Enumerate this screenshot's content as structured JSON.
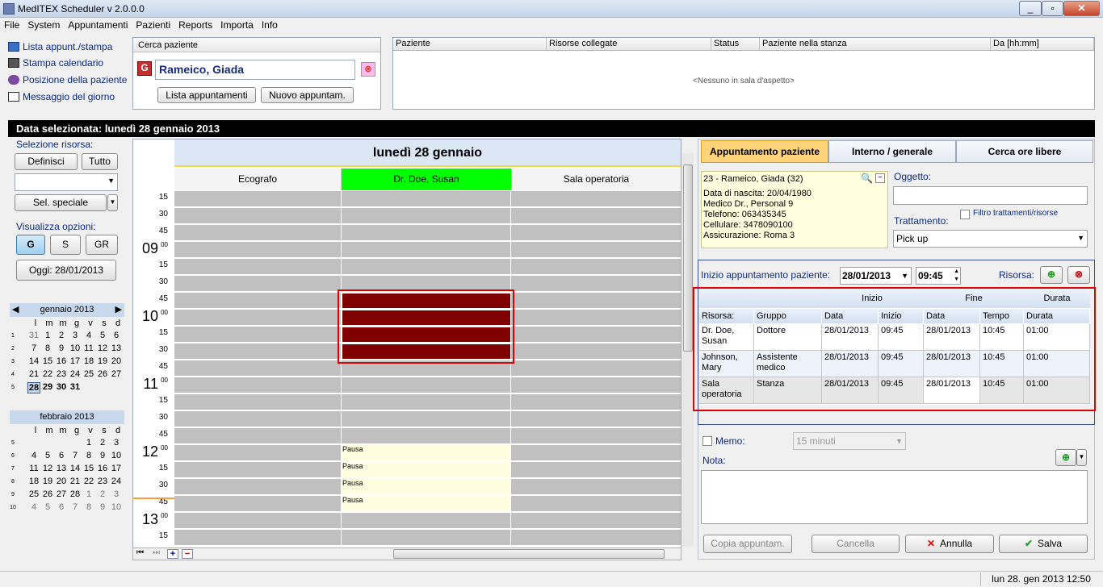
{
  "window": {
    "title": "MedITEX  Scheduler v 2.0.0.0",
    "min": "_",
    "max": "▫",
    "close": "✕"
  },
  "menu": [
    "File",
    "System",
    "Appuntamenti",
    "Pazienti",
    "Reports",
    "Importa",
    "Info"
  ],
  "left_links": [
    "Lista appunt./stampa",
    "Stampa calendario",
    "Posizione della paziente",
    "Messaggio del giorno"
  ],
  "search": {
    "title": "Cerca paziente",
    "patient": "Rameico, Giada",
    "btn_list": "Lista appuntamenti",
    "btn_new": "Nuovo appuntam."
  },
  "waiting": {
    "columns": [
      "Paziente",
      "Risorse collegate",
      "Status",
      "Paziente nella stanza",
      "Da [hh:mm]"
    ],
    "empty": "<Nessuno in sala d'aspetto>"
  },
  "selected_date": "Data selezionata: lunedì 28 gennaio 2013",
  "sidebar": {
    "sel_label": "Selezione risorsa:",
    "definisci": "Definisci",
    "tutto": "Tutto",
    "sel_speciale": "Sel. speciale",
    "vis_label": "Visualizza opzioni:",
    "opt_g": "G",
    "opt_s": "S",
    "opt_gr": "GR",
    "oggi": "Oggi: 28/01/2013"
  },
  "cal_jan": {
    "title": "gennaio 2013",
    "days": [
      "l",
      "m",
      "m",
      "g",
      "v",
      "d"
    ],
    "weeks": [
      {
        "w": "1",
        "d": [
          "31",
          "1",
          "2",
          "3",
          "4",
          "5",
          "6"
        ]
      },
      {
        "w": "2",
        "d": [
          "7",
          "8",
          "9",
          "10",
          "11",
          "12",
          "13"
        ]
      },
      {
        "w": "3",
        "d": [
          "14",
          "15",
          "16",
          "17",
          "18",
          "19",
          "20"
        ]
      },
      {
        "w": "4",
        "d": [
          "21",
          "22",
          "23",
          "24",
          "25",
          "26",
          "27"
        ]
      },
      {
        "w": "5",
        "d": [
          "28",
          "29",
          "30",
          "31",
          "",
          "",
          ""
        ]
      }
    ]
  },
  "cal_feb": {
    "title": "febbraio 2013",
    "days": [
      "l",
      "m",
      "m",
      "g",
      "v",
      "d"
    ],
    "weeks": [
      {
        "w": "5",
        "d": [
          "",
          "",
          "",
          "",
          "1",
          "2",
          "3"
        ]
      },
      {
        "w": "6",
        "d": [
          "4",
          "5",
          "6",
          "7",
          "8",
          "9",
          "10"
        ]
      },
      {
        "w": "7",
        "d": [
          "11",
          "12",
          "13",
          "14",
          "15",
          "16",
          "17"
        ]
      },
      {
        "w": "8",
        "d": [
          "18",
          "19",
          "20",
          "21",
          "22",
          "23",
          "24"
        ]
      },
      {
        "w": "9",
        "d": [
          "25",
          "26",
          "27",
          "28",
          "1",
          "2",
          "3"
        ]
      },
      {
        "w": "10",
        "d": [
          "4",
          "5",
          "6",
          "7",
          "8",
          "9",
          "10"
        ]
      }
    ]
  },
  "day": {
    "title": "lunedì 28 gennaio",
    "resources": [
      "Ecografo",
      "Dr. Doe, Susan",
      "Sala operatoria"
    ],
    "times": [
      {
        "h": "",
        "m": "15"
      },
      {
        "h": "",
        "m": "30"
      },
      {
        "h": "",
        "m": "45"
      },
      {
        "h": "09",
        "m": "00"
      },
      {
        "h": "",
        "m": "15"
      },
      {
        "h": "",
        "m": "30"
      },
      {
        "h": "",
        "m": "45"
      },
      {
        "h": "10",
        "m": "00"
      },
      {
        "h": "",
        "m": "15"
      },
      {
        "h": "",
        "m": "30"
      },
      {
        "h": "",
        "m": "45"
      },
      {
        "h": "11",
        "m": "00"
      },
      {
        "h": "",
        "m": "15"
      },
      {
        "h": "",
        "m": "30"
      },
      {
        "h": "",
        "m": "45"
      },
      {
        "h": "12",
        "m": "00"
      },
      {
        "h": "",
        "m": "15"
      },
      {
        "h": "",
        "m": "30"
      },
      {
        "h": "",
        "m": "45"
      },
      {
        "h": "13",
        "m": "00"
      },
      {
        "h": "",
        "m": "15"
      }
    ],
    "pausa": "Pausa"
  },
  "tabs": [
    "Appuntamento paziente",
    "Interno / generale",
    "Cerca ore libere"
  ],
  "patient": {
    "line1": "23 - Rameico, Giada (32)",
    "lines": [
      "Data di nascita: 20/04/1980",
      "Medico Dr., Personal 9",
      "Telefono:  063435345",
      "Cellulare: 3478090100",
      "Assicurazione: Roma 3"
    ]
  },
  "form": {
    "oggetto": "Oggetto:",
    "trattamento": "Trattamento:",
    "filtro": "Filtro trattamenti/risorse",
    "trattamento_val": "Pick up",
    "inizio": "Inizio appuntamento paziente:",
    "date": "28/01/2013",
    "time": "09:45",
    "risorsa": "Risorsa:"
  },
  "rtable": {
    "groups": [
      "Inizio",
      "Fine",
      "Durata"
    ],
    "cols": [
      "Risorsa:",
      "Gruppo",
      "Data",
      "Inizio",
      "Data",
      "Tempo",
      "Durata"
    ],
    "rows": [
      [
        "Dr. Doe, Susan",
        "Dottore",
        "28/01/2013",
        "09:45",
        "28/01/2013",
        "10:45",
        "01:00"
      ],
      [
        "Johnson, Mary",
        "Assistente medico",
        "28/01/2013",
        "09:45",
        "28/01/2013",
        "10:45",
        "01:00"
      ],
      [
        "Sala operatoria",
        "Stanza",
        "28/01/2013",
        "09:45",
        "28/01/2013",
        "10:45",
        "01:00"
      ]
    ]
  },
  "memo": {
    "label": "Memo:",
    "value": "15 minuti",
    "nota": "Nota:"
  },
  "actions": {
    "copia": "Copia appuntam.",
    "cancella": "Cancella",
    "annulla": "Annulla",
    "salva": "Salva"
  },
  "statusbar": "lun 28. gen 2013 12:50",
  "colors": {
    "booked": "#800000",
    "doctor_header": "#00ff00",
    "pausa": "#fffde0",
    "highlight": "#e00000"
  }
}
